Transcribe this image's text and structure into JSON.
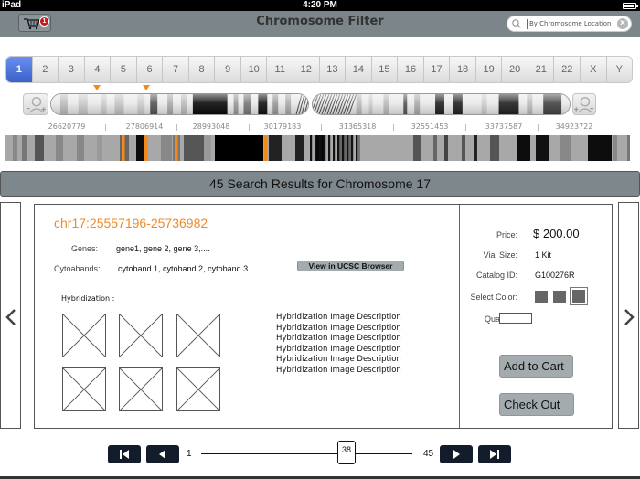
{
  "status_bar": {
    "carrier": "iPad",
    "time": "4:20 PM"
  },
  "nav": {
    "title": "Chromosome Filter",
    "cart_badge": "1",
    "search": {
      "value": "",
      "placeholder": "By Chromosome Location",
      "clear_icon": "×"
    }
  },
  "chromosome_tabs": {
    "selected": "1",
    "items": [
      "1",
      "2",
      "3",
      "4",
      "5",
      "6",
      "7",
      "8",
      "9",
      "10",
      "11",
      "12",
      "13",
      "14",
      "15",
      "16",
      "17",
      "18",
      "19",
      "20",
      "21",
      "22",
      "X",
      "Y"
    ]
  },
  "ideogram": {
    "zoom_out_label": "zoom-out",
    "zoom_in_label": "zoom-in",
    "markers": [
      4,
      6
    ]
  },
  "scale_labels": [
    "26620779",
    "27806914",
    "28993048",
    "30179183",
    "31365318",
    "32551453",
    "33737587",
    "34923722"
  ],
  "results_header": "45 Search Results for Chromosome 17",
  "result": {
    "locus": "chr17:25557196-25736982",
    "genes_label": "Genes:",
    "genes_value": "gene1, gene 2, gene 3,....",
    "cytobands_label": "Cytoabands:",
    "cytobands_value": "cytoband 1, cytoband 2, cytoband 3",
    "ucsc_button": "View in UCSC Browser",
    "hybridization_label": "Hybridization :",
    "image_descriptions": [
      "Hybridization Image Description",
      "Hybridization Image Description",
      "Hybridization Image Description",
      "Hybridization Image Description",
      "Hybridization Image Description",
      "Hybridization Image Description"
    ],
    "price_label": "Price:",
    "price_value": "$ 200.00",
    "vial_label": "Vial Size:",
    "vial_value": "1 Kit",
    "catalog_label": "Catalog ID:",
    "catalog_value": "G100276R",
    "color_label": "Select Color:",
    "color_selected_index": 2,
    "quantity_label": "Quantity:",
    "quantity_value": "",
    "add_to_cart": "Add to Cart",
    "check_out": "Check Out"
  },
  "pagination": {
    "min": "1",
    "max": "45",
    "current": "38"
  },
  "colors": {
    "accent_orange": "#ef8a2b",
    "tab_active": "#3a61c9",
    "nav_gray": "#7c868a",
    "button_dark": "#121c2a"
  }
}
